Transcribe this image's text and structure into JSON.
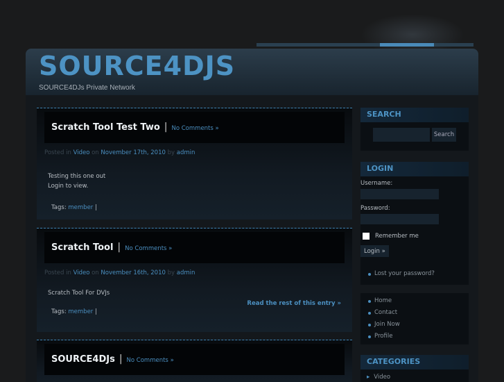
{
  "site": {
    "title": "SOURCE4DJS",
    "tagline": "SOURCE4DJs Private Network"
  },
  "posts": [
    {
      "title": "Scratch Tool Test Two",
      "comments": "No Comments »",
      "posted_in": "Posted in",
      "category": "Video",
      "on": "on",
      "date": "November 17th, 2010",
      "by": "by",
      "author": "admin",
      "body": [
        "Testing this one out",
        "Login to view."
      ],
      "tags_label": "Tags:",
      "tag": "member",
      "tag_sep": "|"
    },
    {
      "title": "Scratch Tool",
      "comments": "No Comments »",
      "posted_in": "Posted in",
      "category": "Video",
      "on": "on",
      "date": "November 16th, 2010",
      "by": "by",
      "author": "admin",
      "body": [
        "Scratch Tool For DVJs"
      ],
      "read_more": "Read the rest of this entry »",
      "tags_label": "Tags:",
      "tag": "member",
      "tag_sep": "|"
    },
    {
      "title": "SOURCE4DJs",
      "comments": "No Comments »"
    }
  ],
  "sidebar": {
    "search": {
      "heading": "SEARCH",
      "button": "Search",
      "value": ""
    },
    "login": {
      "heading": "LOGIN",
      "username_label": "Username:",
      "password_label": "Password:",
      "remember": "Remember me",
      "button": "Login »",
      "lost": "Lost your password?"
    },
    "menu": [
      "Home",
      "Contact",
      "Join Now",
      "Profile"
    ],
    "categories": {
      "heading": "CATEGORIES",
      "items": [
        "Video"
      ]
    }
  }
}
